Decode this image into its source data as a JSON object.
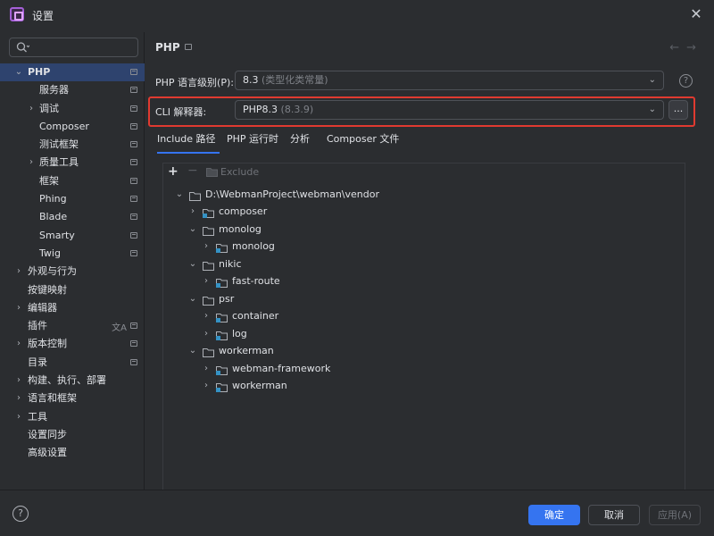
{
  "window": {
    "title": "设置"
  },
  "search": {
    "value": ""
  },
  "sidebar": {
    "items": [
      {
        "label": "PHP",
        "depth": 0,
        "chevron": "expanded",
        "pin": true,
        "selected": true,
        "bold": true
      },
      {
        "label": "服务器",
        "depth": 1,
        "chevron": "none",
        "pin": true
      },
      {
        "label": "调试",
        "depth": 1,
        "chevron": "collapsed",
        "pin": true
      },
      {
        "label": "Composer",
        "depth": 1,
        "chevron": "none",
        "pin": true
      },
      {
        "label": "测试框架",
        "depth": 1,
        "chevron": "none",
        "pin": true
      },
      {
        "label": "质量工具",
        "depth": 1,
        "chevron": "collapsed",
        "pin": true
      },
      {
        "label": "框架",
        "depth": 1,
        "chevron": "none",
        "pin": true
      },
      {
        "label": "Phing",
        "depth": 1,
        "chevron": "none",
        "pin": true
      },
      {
        "label": "Blade",
        "depth": 1,
        "chevron": "none",
        "pin": true
      },
      {
        "label": "Smarty",
        "depth": 1,
        "chevron": "none",
        "pin": true
      },
      {
        "label": "Twig",
        "depth": 1,
        "chevron": "none",
        "pin": true
      },
      {
        "label": "外观与行为",
        "depth": 0,
        "chevron": "collapsed",
        "pin": false
      },
      {
        "label": "按键映射",
        "depth": 0,
        "chevron": "none",
        "pin": false
      },
      {
        "label": "编辑器",
        "depth": 0,
        "chevron": "collapsed",
        "pin": false
      },
      {
        "label": "插件",
        "depth": 0,
        "chevron": "none",
        "pin": true,
        "translate": true
      },
      {
        "label": "版本控制",
        "depth": 0,
        "chevron": "collapsed",
        "pin": true
      },
      {
        "label": "目录",
        "depth": 0,
        "chevron": "none",
        "pin": true
      },
      {
        "label": "构建、执行、部署",
        "depth": 0,
        "chevron": "collapsed",
        "pin": false
      },
      {
        "label": "语言和框架",
        "depth": 0,
        "chevron": "collapsed",
        "pin": false
      },
      {
        "label": "工具",
        "depth": 0,
        "chevron": "collapsed",
        "pin": false
      },
      {
        "label": "设置同步",
        "depth": 0,
        "chevron": "none",
        "pin": false
      },
      {
        "label": "高级设置",
        "depth": 0,
        "chevron": "none",
        "pin": false
      }
    ]
  },
  "main": {
    "title": "PHP",
    "language_level": {
      "label": "PHP 语言级别(P):",
      "value": "8.3",
      "detail": "(类型化类常量)"
    },
    "cli": {
      "label": "CLI 解释器:",
      "value": "PHP8.3",
      "detail": "(8.3.9)",
      "more_label": "..."
    },
    "tabs": [
      "Include 路径",
      "PHP 运行时",
      "分析",
      "Composer 文件"
    ],
    "active_tab": 0,
    "toolbar": {
      "exclude_label": "Exclude"
    },
    "include_tree": [
      {
        "label": "D:\\WebmanProject\\webman\\vendor",
        "depth": 0,
        "chevron": "expanded",
        "icon": "folder"
      },
      {
        "label": "composer",
        "depth": 1,
        "chevron": "collapsed",
        "icon": "module-folder"
      },
      {
        "label": "monolog",
        "depth": 1,
        "chevron": "expanded",
        "icon": "folder"
      },
      {
        "label": "monolog",
        "depth": 2,
        "chevron": "collapsed",
        "icon": "module-folder"
      },
      {
        "label": "nikic",
        "depth": 1,
        "chevron": "expanded",
        "icon": "folder"
      },
      {
        "label": "fast-route",
        "depth": 2,
        "chevron": "collapsed",
        "icon": "module-folder"
      },
      {
        "label": "psr",
        "depth": 1,
        "chevron": "expanded",
        "icon": "folder"
      },
      {
        "label": "container",
        "depth": 2,
        "chevron": "collapsed",
        "icon": "module-folder"
      },
      {
        "label": "log",
        "depth": 2,
        "chevron": "collapsed",
        "icon": "module-folder"
      },
      {
        "label": "workerman",
        "depth": 1,
        "chevron": "expanded",
        "icon": "folder"
      },
      {
        "label": "webman-framework",
        "depth": 2,
        "chevron": "collapsed",
        "icon": "module-folder"
      },
      {
        "label": "workerman",
        "depth": 2,
        "chevron": "collapsed",
        "icon": "module-folder"
      }
    ]
  },
  "footer": {
    "ok_label": "确定",
    "cancel_label": "取消",
    "apply_label": "应用(A)"
  },
  "colors": {
    "accent": "#3574f0",
    "highlight": "#e03a30",
    "selection": "#2e436e",
    "background": "#2b2d30"
  }
}
